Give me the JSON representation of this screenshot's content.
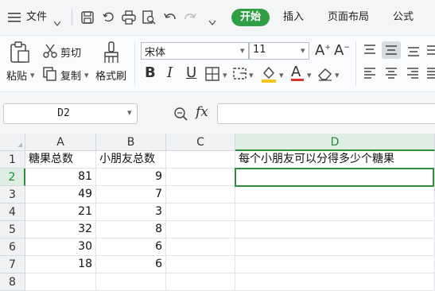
{
  "menubar": {
    "file_label": "文件",
    "tabs": [
      "开始",
      "插入",
      "页面布局",
      "公式"
    ],
    "active_tab": "开始"
  },
  "ribbon": {
    "paste_label": "粘贴",
    "cut_label": "剪切",
    "copy_label": "复制",
    "format_painter_label": "格式刷",
    "font_name": "宋体",
    "font_size": "11",
    "bold": "B",
    "italic": "I",
    "underline": "U",
    "font_grow": "A",
    "font_shrink": "A",
    "font_color_letter": "A"
  },
  "formula_bar": {
    "name_box": "D2",
    "fx_label": "fx",
    "formula": ""
  },
  "sheet": {
    "column_headers": [
      "A",
      "B",
      "C",
      "D"
    ],
    "row_headers": [
      "1",
      "2",
      "3",
      "4",
      "5",
      "6",
      "7",
      "8"
    ],
    "selected_column": "D",
    "selected_row": "2",
    "header_row": [
      "糖果总数",
      "小朋友总数",
      "",
      "每个小朋友可以分得多少个糖果"
    ],
    "rows": [
      [
        "81",
        "9",
        "",
        ""
      ],
      [
        "49",
        "7",
        "",
        ""
      ],
      [
        "21",
        "3",
        "",
        ""
      ],
      [
        "32",
        "8",
        "",
        ""
      ],
      [
        "30",
        "6",
        "",
        ""
      ],
      [
        "18",
        "6",
        "",
        ""
      ],
      [
        "",
        "",
        "",
        ""
      ]
    ]
  },
  "colors": {
    "accent_green": "#2f9e44",
    "selection_green": "#2f8f3f",
    "font_color_red": "#e03131",
    "highlight_yellow": "#f5c518"
  }
}
